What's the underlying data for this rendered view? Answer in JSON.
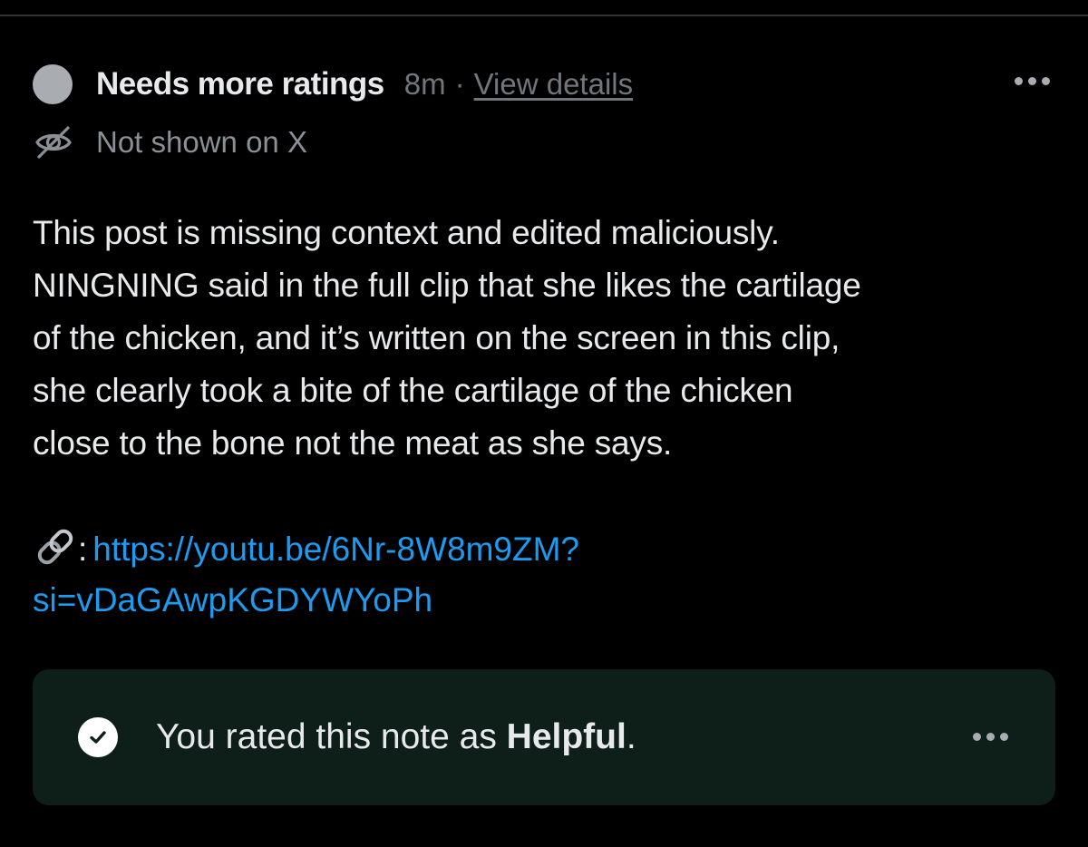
{
  "note": {
    "status": "Needs more ratings",
    "time_ago": "8m",
    "separator": "·",
    "view_details": "View details",
    "visibility": "Not shown on X",
    "body": "This post is missing context and edited maliciously.\nNINGNING said in the full clip that she likes the cartilage\nof the chicken, and it’s written on the screen in this clip,\nshe clearly took a bite of the cartilage of the chicken\nclose to the bone not the meat as she says.",
    "source_separator": ":",
    "source_url_line1": "https://youtu.be/6Nr-8W8m9ZM?",
    "source_url_line2": "si=vDaGAwpKGDYWYoPh",
    "icons": {
      "status": "status-dot",
      "visibility": "eye-slash-icon",
      "source": "link-icon",
      "more": "more-horizontal-icon",
      "rated": "check-circle-icon"
    }
  },
  "rating": {
    "prefix": "You rated this note as ",
    "value": "Helpful",
    "suffix": "."
  },
  "colors": {
    "background": "#000000",
    "text_primary": "#e7e9ea",
    "text_secondary": "#71767b",
    "link": "#1d9bf0",
    "banner_background": "#0e1f1a",
    "status_dot": "#a9acb0"
  }
}
